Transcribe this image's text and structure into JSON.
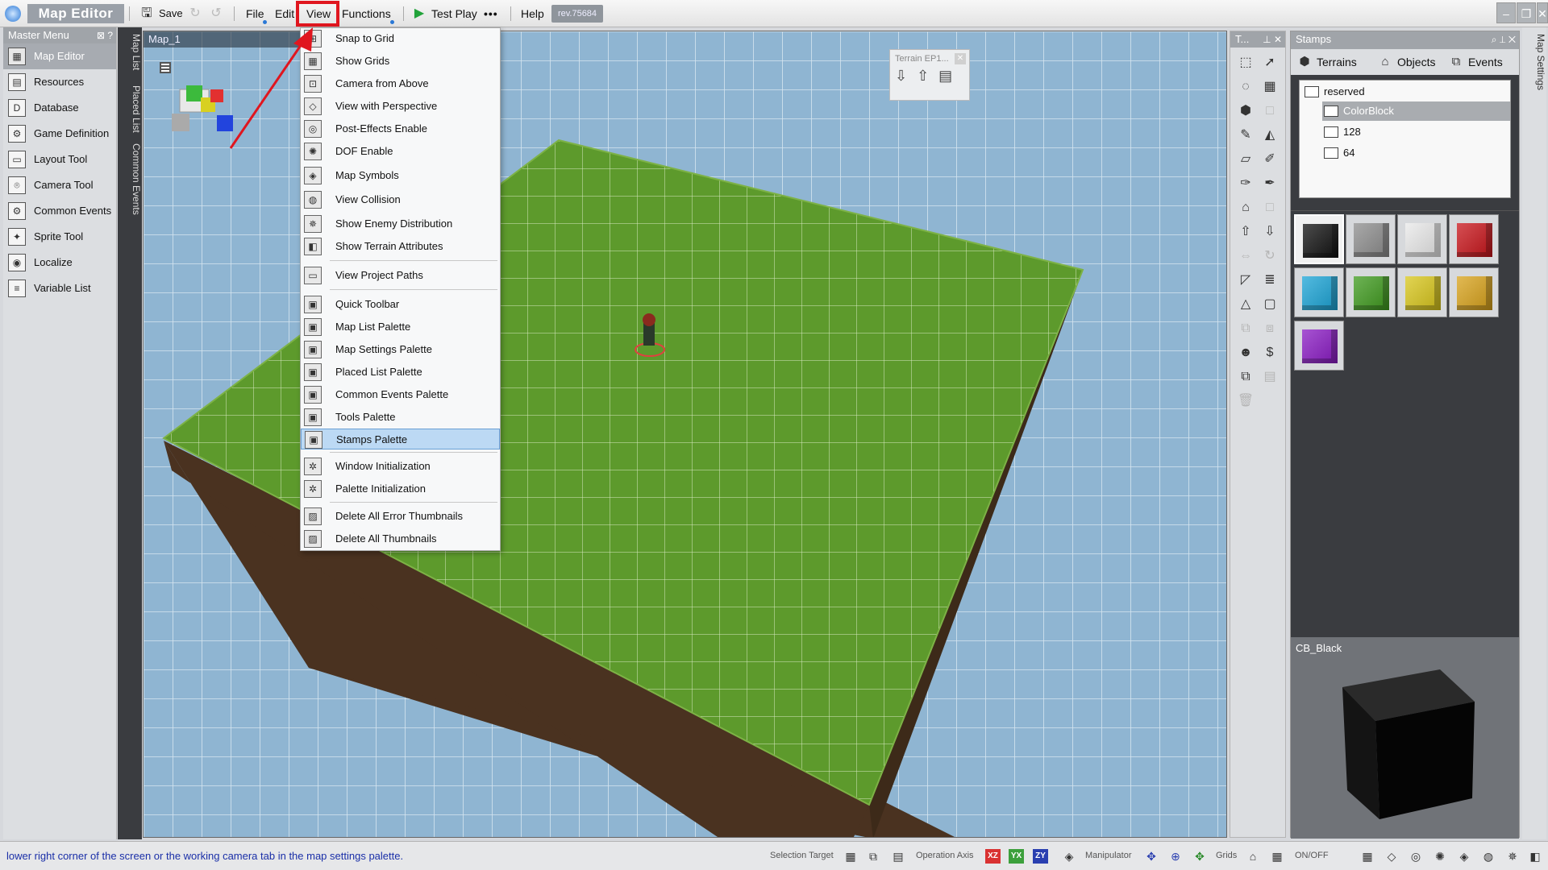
{
  "app": {
    "title": "Map Editor"
  },
  "toolbar": {
    "save_label": "Save",
    "menus": [
      "File",
      "Edit",
      "View",
      "Functions"
    ],
    "test_play_label": "Test Play",
    "help_label": "Help",
    "revision": "rev.75684"
  },
  "left_panel": {
    "header": "Master Menu",
    "header_icons": "⊠ ?",
    "items": [
      {
        "label": "Map Editor",
        "icon": "map-editor-icon",
        "glyph": "▦"
      },
      {
        "label": "Resources",
        "icon": "resources-icon",
        "glyph": "▤"
      },
      {
        "label": "Database",
        "icon": "database-icon",
        "glyph": "D"
      },
      {
        "label": "Game Definition",
        "icon": "game-definition-icon",
        "glyph": "⚙"
      },
      {
        "label": "Layout Tool",
        "icon": "layout-tool-icon",
        "glyph": "▭"
      },
      {
        "label": "Camera Tool",
        "icon": "camera-tool-icon",
        "glyph": "⌾"
      },
      {
        "label": "Common Events",
        "icon": "common-events-icon",
        "glyph": "⚙"
      },
      {
        "label": "Sprite Tool",
        "icon": "sprite-tool-icon",
        "glyph": "✦"
      },
      {
        "label": "Localize",
        "icon": "localize-icon",
        "glyph": "◉"
      },
      {
        "label": "Variable List",
        "icon": "variable-list-icon",
        "glyph": "≡"
      }
    ]
  },
  "vtabs": [
    "Map List",
    "Placed List",
    "Common Events"
  ],
  "viewport": {
    "tab_label": "Map_1",
    "float_toolbar_title": "Terrain EP1..."
  },
  "view_menu": {
    "items": [
      {
        "label": "Snap to Grid",
        "icon": "snap-grid-icon",
        "glyph": "⊞"
      },
      {
        "label": "Show Grids",
        "icon": "grid-icon",
        "glyph": "▦"
      },
      {
        "label": "Camera from Above",
        "icon": "camera-above-icon",
        "glyph": "⊡"
      },
      {
        "label": "View with Perspective",
        "icon": "perspective-icon",
        "glyph": "◇"
      },
      {
        "label": "Post-Effects Enable",
        "icon": "post-effects-icon",
        "glyph": "◎"
      },
      {
        "label": "DOF Enable",
        "icon": "dof-icon",
        "glyph": "✺"
      },
      {
        "label": "Map Symbols",
        "icon": "map-symbols-icon",
        "glyph": "◈"
      },
      {
        "label": "View Collision",
        "icon": "collision-icon",
        "glyph": "◍"
      },
      {
        "label": "Show Enemy Distribution",
        "icon": "enemy-icon",
        "glyph": "✵"
      },
      {
        "label": "Show Terrain Attributes",
        "icon": "terrain-attributes-icon",
        "glyph": "◧"
      },
      {
        "label": "View Project Paths",
        "icon": "folder-icon",
        "glyph": "▭"
      },
      {
        "label": "Quick Toolbar",
        "icon": "palette-icon",
        "glyph": "▣"
      },
      {
        "label": "Map List Palette",
        "icon": "palette-icon",
        "glyph": "▣"
      },
      {
        "label": "Map Settings Palette",
        "icon": "palette-icon",
        "glyph": "▣"
      },
      {
        "label": "Placed List Palette",
        "icon": "palette-icon",
        "glyph": "▣"
      },
      {
        "label": "Common Events Palette",
        "icon": "palette-icon",
        "glyph": "▣"
      },
      {
        "label": "Tools Palette",
        "icon": "palette-icon",
        "glyph": "▣"
      },
      {
        "label": "Stamps Palette",
        "icon": "palette-icon",
        "glyph": "▣"
      },
      {
        "label": "Window Initialization",
        "icon": "reset-icon",
        "glyph": "✲"
      },
      {
        "label": "Palette Initialization",
        "icon": "reset-icon",
        "glyph": "✲"
      },
      {
        "label": "Delete All Error Thumbnails",
        "icon": "thumbnail-icon",
        "glyph": "▨"
      },
      {
        "label": "Delete All Thumbnails",
        "icon": "thumbnail-icon",
        "glyph": "▨"
      }
    ]
  },
  "tools_panel": {
    "header": "T..."
  },
  "stamps_panel": {
    "header": "Stamps",
    "tabs": [
      "Terrains",
      "Objects",
      "Events"
    ],
    "tree": [
      "reserved",
      "ColorBlock",
      "128",
      "64"
    ],
    "preview_label": "CB_Black",
    "colors": [
      "#111111",
      "#8d8d8d",
      "#e9e9e9",
      "#c8141a",
      "#1aa4d6",
      "#3e9a1d",
      "#d8c61a",
      "#d8a21a",
      "#8a1ac4"
    ]
  },
  "right_vtab": "Map Settings",
  "status": {
    "message": "lower right corner of the screen or the working camera tab in the map settings palette.",
    "selection_target": "Selection Target",
    "operation_axis": "Operation Axis",
    "axes": [
      "XZ",
      "YX",
      "ZY"
    ],
    "manipulator": "Manipulator",
    "grids": "Grids",
    "on_off": "ON/OFF"
  }
}
